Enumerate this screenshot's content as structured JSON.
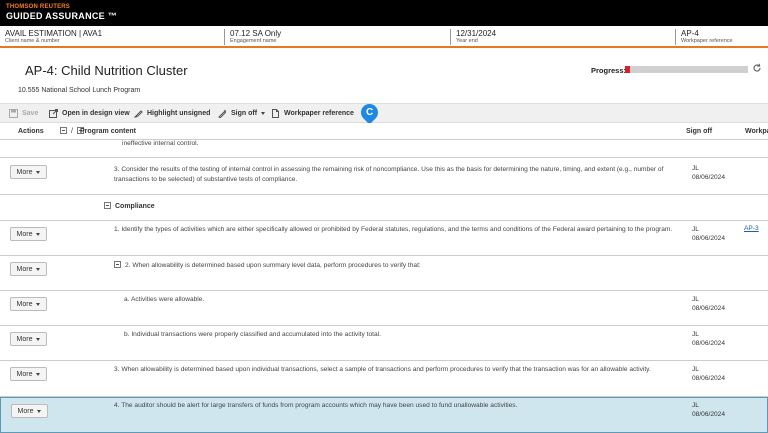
{
  "brand": {
    "line1": "THOMSON REUTERS",
    "line2": "GUIDED ASSURANCE ™"
  },
  "info": [
    {
      "value": "AVAIL ESTIMATION | AVA1",
      "label": "Client name & number"
    },
    {
      "value": "07.12 SA Only",
      "label": "Engagement name"
    },
    {
      "value": "12/31/2024",
      "label": "Year end"
    },
    {
      "value": "AP-4",
      "label": "Workpaper reference"
    }
  ],
  "page": {
    "title": "AP-4: Child Nutrition Cluster",
    "subtitle": "10.555 National School Lunch Program"
  },
  "progress": {
    "label": "Progress:",
    "fraction": 0.04,
    "color": "#e31b23"
  },
  "toolbar": {
    "save": "Save",
    "design_view": "Open in design view",
    "highlight": "Highlight unsigned",
    "signoff": "Sign off",
    "wp_ref": "Workpaper reference",
    "help_badge": "C"
  },
  "grid": {
    "headers": {
      "actions": "Actions",
      "content": "Program content",
      "signoff": "Sign off",
      "workpaper": "Workpaper"
    },
    "more_label": "More",
    "rows": {
      "r0": {
        "text": "ineffective internal control."
      },
      "r1": {
        "text": "3. Consider the results of the testing of internal control in assessing the remaining risk of noncompliance. Use this as the basis for determining the nature, timing, and extent (e.g., number of transactions to be selected) of substantive tests of compliance.",
        "initials": "JL",
        "date": "08/06/2024"
      },
      "r2": {
        "text": "Compliance"
      },
      "r3": {
        "text": "1. Identify the types of activities which are either specifically allowed or prohibited by Federal statutes, regulations, and the terms and conditions of the Federal award pertaining to the program.",
        "initials": "JL",
        "date": "08/06/2024",
        "wp": "AP-3"
      },
      "r4": {
        "text": "2. When allowability is determined based upon summary level data, perform procedures to verify that:"
      },
      "r5": {
        "text": "a. Activities were allowable.",
        "initials": "JL",
        "date": "08/06/2024"
      },
      "r6": {
        "text": "b. Individual transactions were properly classified and accumulated into the activity total.",
        "initials": "JL",
        "date": "08/06/2024"
      },
      "r7": {
        "text": "3. When allowability is determined based upon individual transactions, select a sample of transactions and perform procedures to verify that the transaction was for an allowable activity.",
        "initials": "JL",
        "date": "08/06/2024"
      },
      "r8": {
        "text": "4. The auditor should be alert for large transfers of funds from program accounts which may have been used to fund unallowable activities.",
        "initials": "JL",
        "date": "08/06/2024"
      }
    }
  },
  "colors": {
    "accent": "#e87722",
    "brand_orange": "#ff8000",
    "selected_row": "#cfe6ef",
    "link": "#1a5fb4"
  },
  "icons": [
    "save-icon",
    "design-view-icon",
    "highlight-icon",
    "signoff-icon",
    "workpaper-reference-icon",
    "refresh-icon",
    "caret-down-icon",
    "collapse-icon"
  ]
}
